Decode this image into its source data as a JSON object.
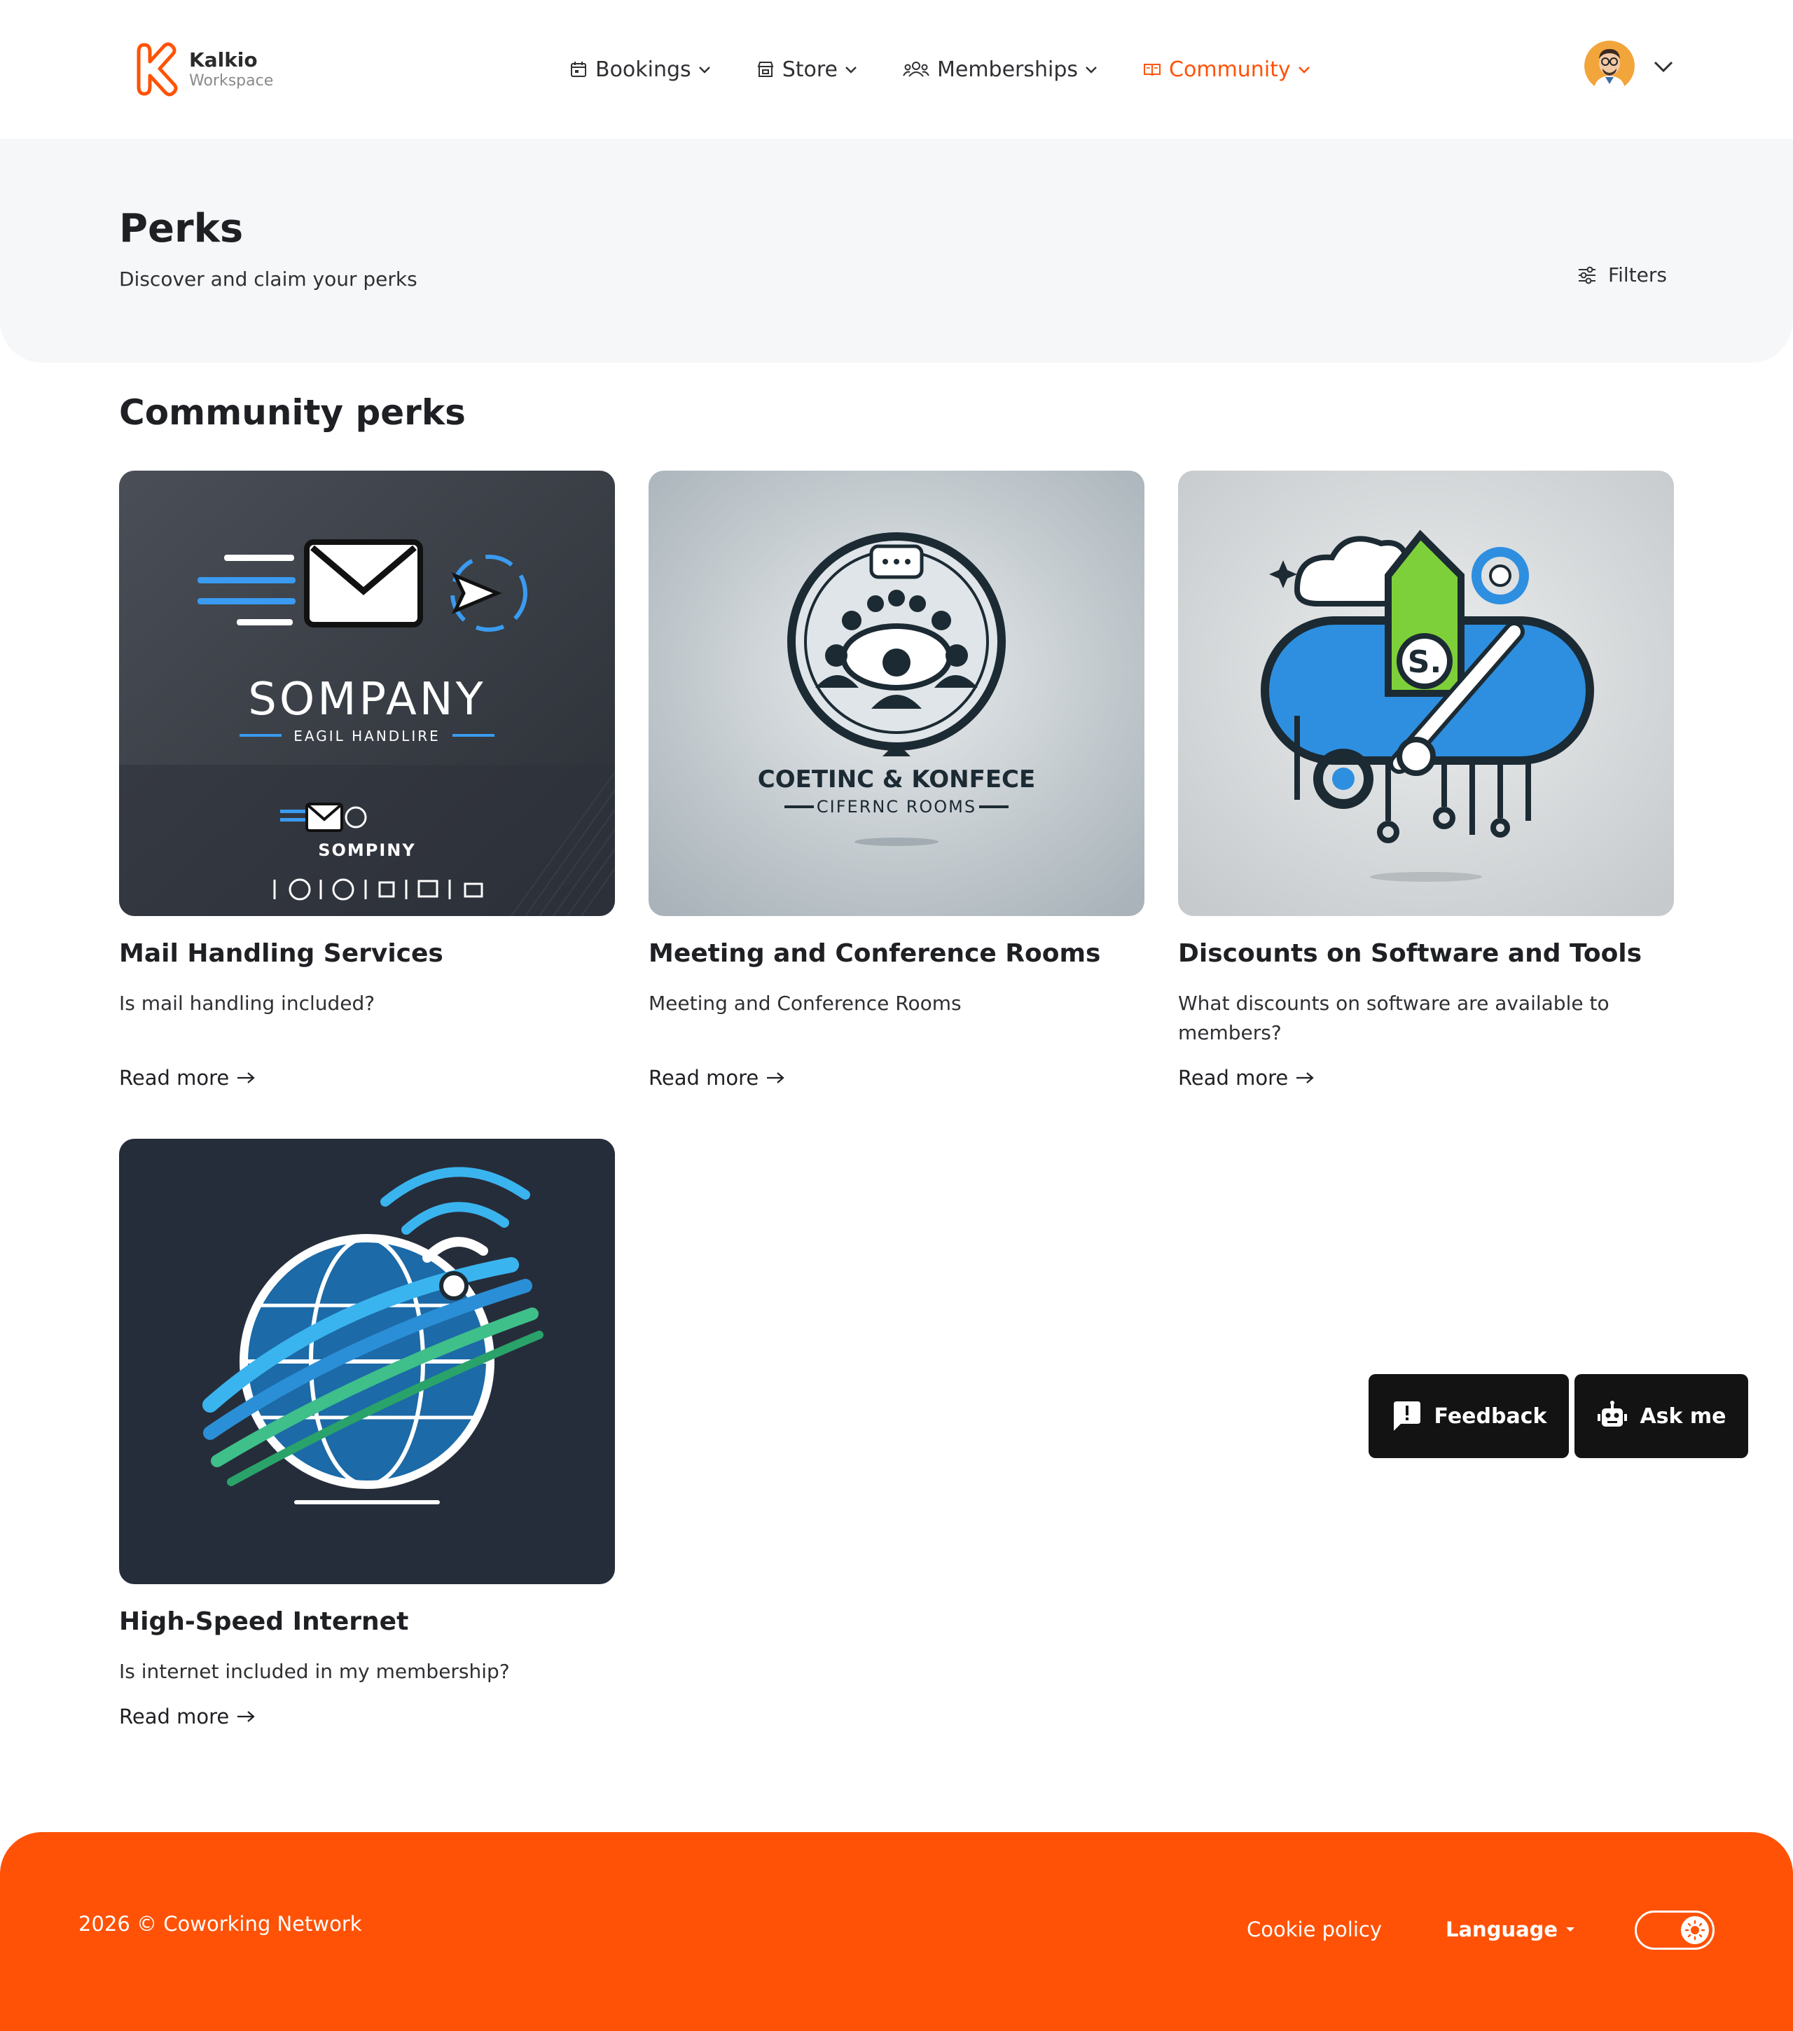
{
  "brand": {
    "name": "Kalkio",
    "subtitle": "Workspace"
  },
  "nav": {
    "items": [
      {
        "label": "Bookings",
        "icon": "calendar-icon"
      },
      {
        "label": "Store",
        "icon": "store-icon"
      },
      {
        "label": "Memberships",
        "icon": "users-icon"
      },
      {
        "label": "Community",
        "icon": "book-icon",
        "active": true
      }
    ]
  },
  "user": {
    "avatar": "user-avatar"
  },
  "hero": {
    "title": "Perks",
    "subtitle": "Discover and claim your perks",
    "filters_label": "Filters"
  },
  "section": {
    "title": "Community perks"
  },
  "cards": [
    {
      "title": "Mail Handling Services",
      "description": "Is mail handling included?",
      "link": "Read more",
      "image": {
        "main_text": "SOMPANY",
        "sub_text": "EAGIL HANDLIRE",
        "small_text": "SOMPINY"
      }
    },
    {
      "title": "Meeting and Conference Rooms",
      "description": "Meeting and Conference Rooms",
      "link": "Read more",
      "image": {
        "line1": "COETINC & KONFECE",
        "line2": "CIFERNC ROOMS"
      }
    },
    {
      "title": "Discounts on Software and Tools",
      "description": "What discounts on software are available to members?",
      "link": "Read more",
      "image": {
        "tag_letter": "S."
      }
    },
    {
      "title": "High-Speed Internet",
      "description": "Is internet included in my membership?",
      "link": "Read more",
      "image": {}
    }
  ],
  "floating": {
    "feedback": "Feedback",
    "ask": "Ask me"
  },
  "footer": {
    "copyright": "2026 © Coworking Network",
    "cookie": "Cookie policy",
    "language": "Language"
  },
  "colors": {
    "accent": "#ff5206",
    "dark": "#131313",
    "text": "#1f2024"
  }
}
